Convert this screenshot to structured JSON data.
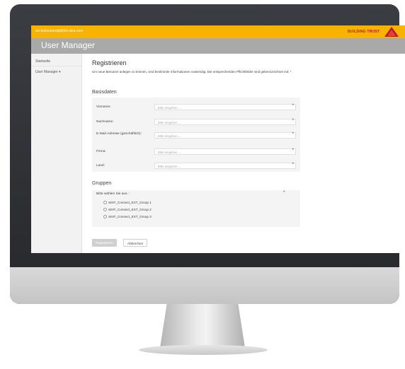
{
  "app": {
    "url": "sis.testsuisesdpt8fch.sika.com",
    "brand": "BUILDING TRUST",
    "logo_text": "Sika",
    "title": "User Manager"
  },
  "sidebar": {
    "items": [
      {
        "label": "Startseite"
      },
      {
        "label": "User Manager ▾"
      }
    ]
  },
  "form": {
    "heading": "Registrieren",
    "intro": "Um neue Benutzer anlegen zu können, sind bestimmte Informationen notwendig. Die entsprechenden Pflichtfelder sind gekennzeichnet mit:",
    "required_marker": "*",
    "basisdaten_title": "Basisdaten",
    "fields": [
      {
        "label": "Vorname:",
        "placeholder": "Bitte eingeben ..."
      },
      {
        "label": "Nachname:",
        "placeholder": "Bitte eingeben ..."
      },
      {
        "label": "E-Mail-Adresse (geschäftlich):",
        "placeholder": "Bitte eingeben ..."
      },
      {
        "label": "Firma:",
        "placeholder": "Bitte eingeben ..."
      },
      {
        "label": "Land:",
        "placeholder": "Bitte eingeben ..."
      }
    ],
    "gruppen_title": "Gruppen",
    "gruppen_prompt": "Bitte wählen Sie aus. :",
    "groups": [
      {
        "label": "SINT_Connect_EXT_Group 1"
      },
      {
        "label": "SINT_Connect_EXT_Group 2"
      },
      {
        "label": "SINT_Connect_EXT_Group 3"
      }
    ],
    "submit_label": "Registrieren",
    "cancel_label": "Abbrechen"
  },
  "colors": {
    "topbar": "#f6b400",
    "titlebar": "#a9a9a9",
    "brand_red": "#c8102e"
  }
}
